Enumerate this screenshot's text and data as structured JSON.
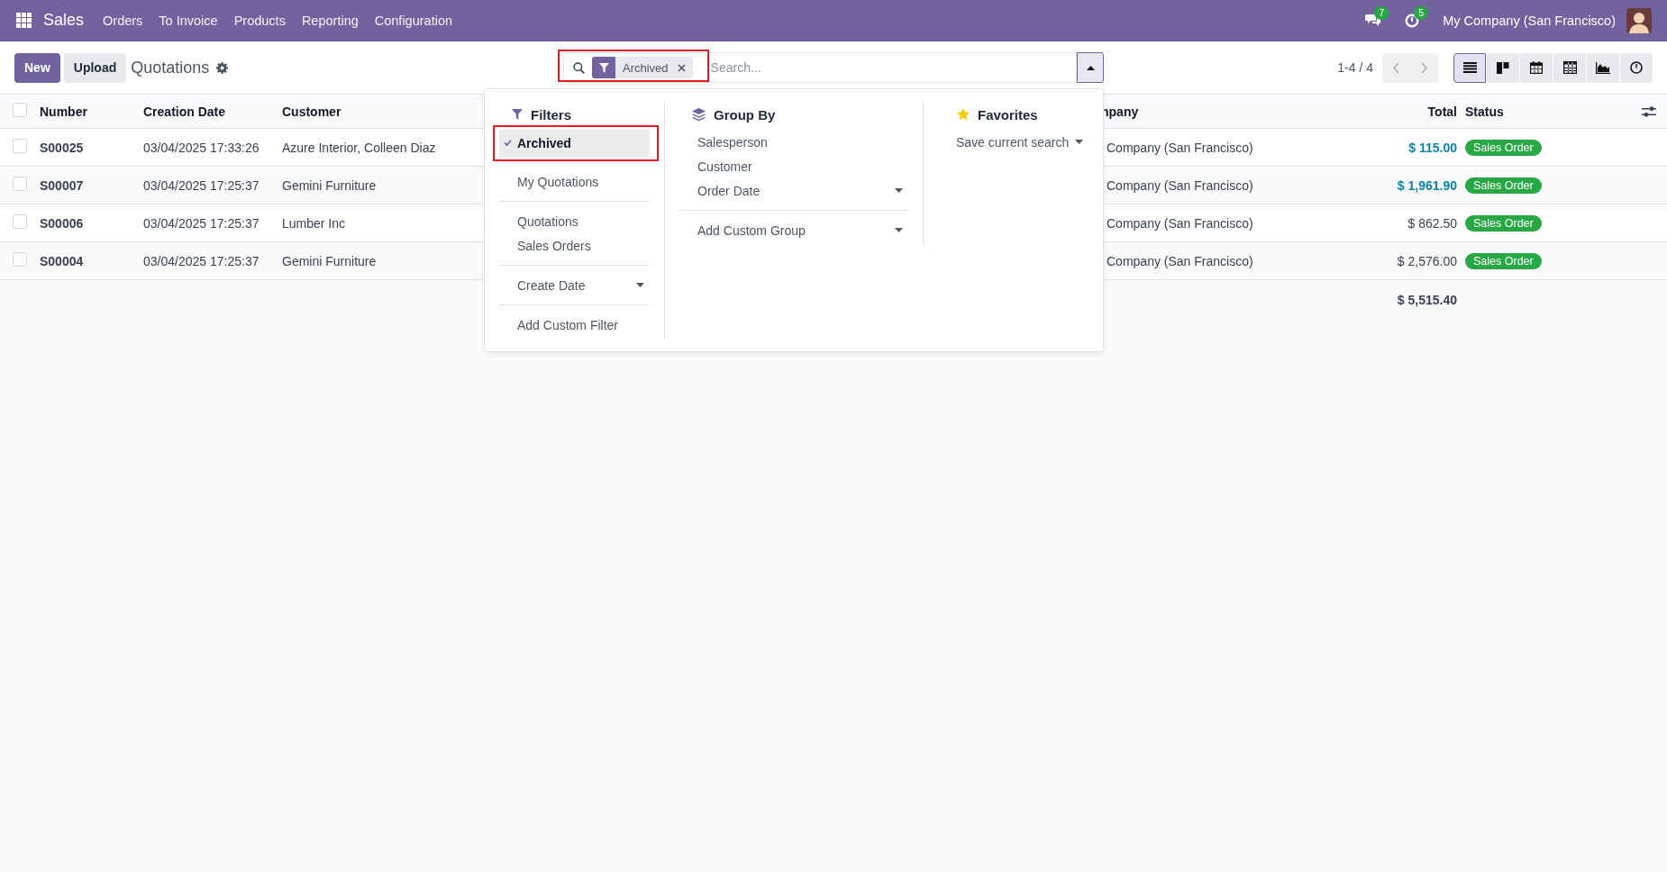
{
  "navbar": {
    "app_name": "Sales",
    "menu": [
      "Orders",
      "To Invoice",
      "Products",
      "Reporting",
      "Configuration"
    ],
    "messages_count": "7",
    "activities_count": "5",
    "company": "My Company (San Francisco)"
  },
  "control_panel": {
    "buttons": [
      {
        "label": "New",
        "kind": "primary"
      },
      {
        "label": "Upload",
        "kind": "secondary"
      }
    ],
    "title": "Quotations",
    "search": {
      "facets": [
        {
          "label": "Archived",
          "kind": "filter",
          "highlighted": true
        }
      ],
      "placeholder": "Search...",
      "expanded": true
    },
    "pager": "1-4 / 4",
    "views": [
      {
        "kind": "list",
        "selected": true
      },
      {
        "kind": "kanban",
        "selected": false
      },
      {
        "kind": "calendar",
        "selected": false
      },
      {
        "kind": "pivot",
        "selected": false
      },
      {
        "kind": "graph",
        "selected": false
      },
      {
        "kind": "activity",
        "selected": false
      }
    ]
  },
  "search_panel": {
    "filters": {
      "title": "Filters",
      "sections": [
        [
          {
            "label": "Archived",
            "kind": "option",
            "selected": true,
            "highlighted": true
          },
          {
            "label": "My Quotations",
            "kind": "option",
            "selected": false,
            "highlighted": false
          }
        ],
        [
          {
            "label": "Quotations",
            "kind": "option",
            "selected": false,
            "highlighted": false
          },
          {
            "label": "Sales Orders",
            "kind": "option",
            "selected": false,
            "highlighted": false
          }
        ],
        [
          {
            "label": "Create Date",
            "kind": "submenu",
            "selected": false,
            "highlighted": false
          }
        ],
        [
          {
            "label": "Add Custom Filter",
            "kind": "option",
            "selected": false,
            "highlighted": false
          }
        ]
      ]
    },
    "group_by": {
      "title": "Group By",
      "sections": [
        [
          {
            "label": "Salesperson",
            "kind": "option",
            "selected": false,
            "highlighted": false
          },
          {
            "label": "Customer",
            "kind": "option",
            "selected": false,
            "highlighted": false
          },
          {
            "label": "Order Date",
            "kind": "submenu",
            "selected": false,
            "highlighted": false
          }
        ],
        [
          {
            "label": "Add Custom Group",
            "kind": "submenu",
            "selected": false,
            "highlighted": false
          }
        ]
      ]
    },
    "favorites": {
      "title": "Favorites",
      "sections": [
        [
          {
            "label": "Save current search",
            "kind": "submenu",
            "selected": false,
            "highlighted": false
          }
        ]
      ]
    }
  },
  "table": {
    "all_selected": false,
    "columns": [
      {
        "label": "Number"
      },
      {
        "label": "Creation Date"
      },
      {
        "label": "Customer"
      },
      {
        "label": "npany"
      },
      {
        "label": "Total"
      },
      {
        "label": "Status"
      }
    ],
    "rows": [
      {
        "selected": false,
        "number": "S00025",
        "creation_date": "03/04/2025 17:33:26",
        "customer": "Azure Interior, Colleen Diaz",
        "company": "Company (San Francisco)",
        "total": "$ 115.00",
        "total_emphasized": true,
        "status": "Sales Order"
      },
      {
        "selected": false,
        "number": "S00007",
        "creation_date": "03/04/2025 17:25:37",
        "customer": "Gemini Furniture",
        "company": "Company (San Francisco)",
        "total": "$ 1,961.90",
        "total_emphasized": true,
        "status": "Sales Order"
      },
      {
        "selected": false,
        "number": "S00006",
        "creation_date": "03/04/2025 17:25:37",
        "customer": "Lumber Inc",
        "company": "Company (San Francisco)",
        "total": "$ 862.50",
        "total_emphasized": false,
        "status": "Sales Order"
      },
      {
        "selected": false,
        "number": "S00004",
        "creation_date": "03/04/2025 17:25:37",
        "customer": "Gemini Furniture",
        "company": "Company (San Francisco)",
        "total": "$ 2,576.00",
        "total_emphasized": false,
        "status": "Sales Order"
      }
    ],
    "sum_total": "$ 5,515.40"
  }
}
